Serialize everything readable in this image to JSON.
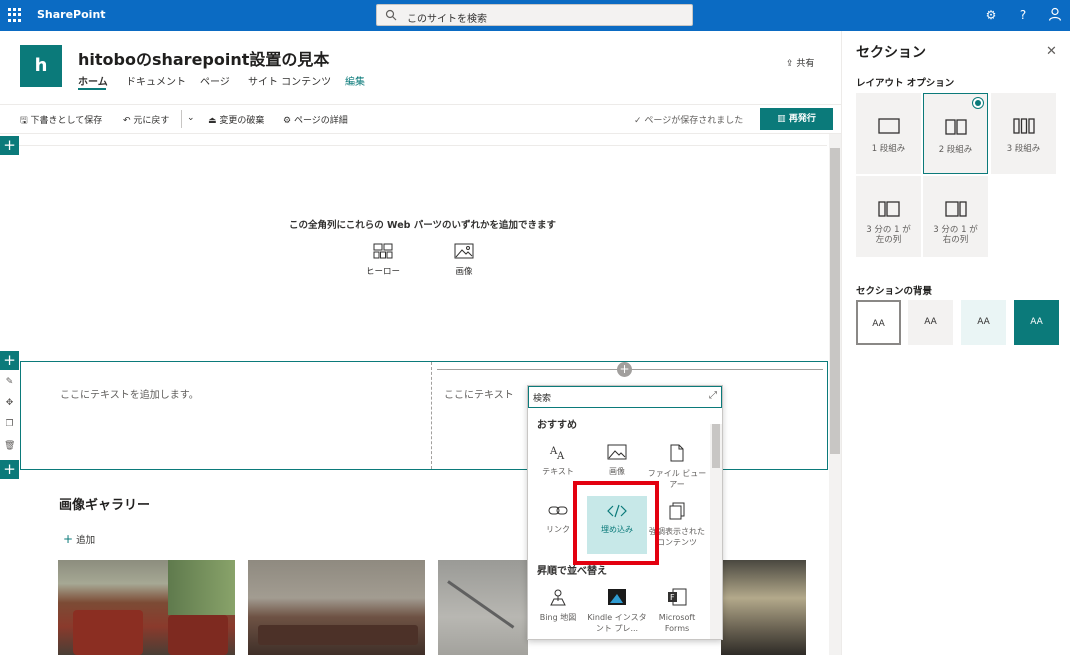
{
  "suite": {
    "brand": "SharePoint",
    "search_placeholder": "このサイトを検索"
  },
  "site": {
    "logo_letter": "h",
    "title": "hitoboのsharepoint設置の見本",
    "nav": [
      "ホーム",
      "ドキュメント",
      "ページ",
      "サイト コンテンツ",
      "編集"
    ],
    "share": "共有"
  },
  "commands": {
    "save_draft": "下書きとして保存",
    "undo": "元に戻す",
    "discard": "変更の破棄",
    "page_details": "ページの詳細",
    "saved_status": "ページが保存されました",
    "republish": "再発行"
  },
  "canvas": {
    "hint": "この全角列にこれらの Web パーツのいずれかを追加できます",
    "webparts": [
      "ヒーロー",
      "画像"
    ],
    "col1_placeholder": "ここにテキストを追加します。",
    "col2_placeholder": "ここにテキスト",
    "gallery_title": "画像ギャラリー",
    "gallery_add": "追加"
  },
  "toolbox": {
    "search_placeholder": "検索",
    "section_featured": "おすすめ",
    "featured": [
      "テキスト",
      "画像",
      "ファイル ビューアー",
      "リンク",
      "埋め込み",
      "強調表示されたコンテンツ"
    ],
    "section_sorted": "昇順で並べ替え",
    "sorted": [
      "Bing 地図",
      "Kindle インスタント プレ...",
      "Microsoft Forms"
    ]
  },
  "pane": {
    "title": "セクション",
    "layout_heading": "レイアウト オプション",
    "layouts": [
      "1 段組み",
      "2 段組み",
      "3 段組み",
      "3 分の 1 が左の列",
      "3 分の 1 が右の列"
    ],
    "selected_layout": "2 段組み",
    "background_heading": "セクションの背景",
    "backgrounds": [
      "AA",
      "AA",
      "AA",
      "AA"
    ],
    "background_colors": [
      "#ffffff",
      "#f3f2f1",
      "#eaf5f5",
      "#0b7a7a"
    ]
  },
  "colors": {
    "suite_bar": "#0b6bc3",
    "accent": "#0b7a7a",
    "highlight": "#e3000f"
  }
}
